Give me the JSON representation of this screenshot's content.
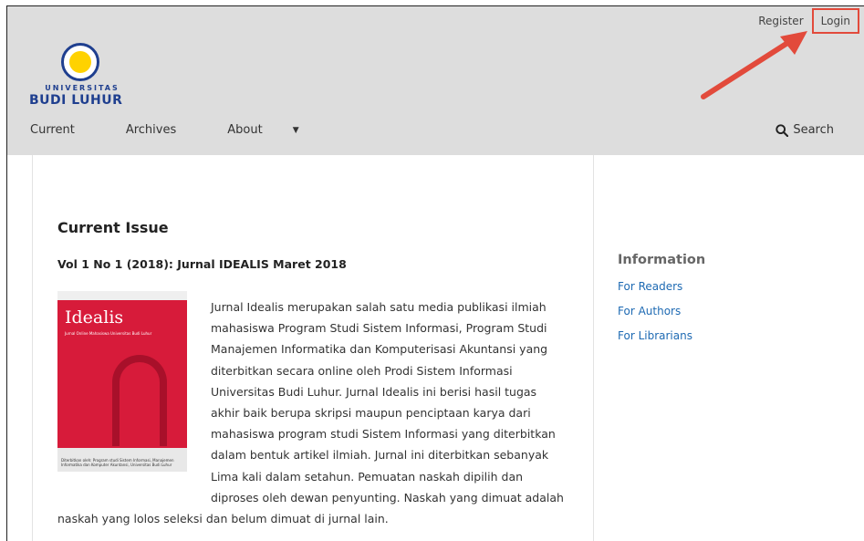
{
  "header": {
    "user_nav": {
      "register": "Register",
      "login": "Login"
    },
    "logo": {
      "line1": "UNIVERSITAS",
      "line2": "BUDI LUHUR"
    },
    "nav": [
      {
        "label": "Current"
      },
      {
        "label": "Archives"
      },
      {
        "label": "About"
      }
    ],
    "search_label": "Search"
  },
  "main": {
    "section_title": "Current Issue",
    "issue_title": "Vol 1 No 1 (2018): Jurnal IDEALIS Maret 2018",
    "cover": {
      "name": "Idealis",
      "subtitle": "Jurnal Online Mahasiswa Universitas Budi Luhur",
      "footer": "Diterbitkan oleh: Program studi Sistem Informasi, Manajemen Informatika dan Komputer Akuntansi, Universitas Budi Luhur"
    },
    "description": "Jurnal Idealis merupakan salah satu media publikasi ilmiah mahasiswa Program Studi Sistem Informasi, Program Studi Manajemen Informatika dan Komputerisasi Akuntansi yang diterbitkan secara online oleh Prodi Sistem Informasi Universitas Budi Luhur. Jurnal Idealis ini berisi hasil tugas akhir baik berupa skripsi maupun penciptaan karya dari mahasiswa program studi Sistem Informasi yang diterbitkan dalam bentuk artikel ilmiah. Jurnal ini diterbitkan sebanyak Lima kali dalam setahun. Pemuatan naskah dipilih dan diproses oleh dewan penyunting. Naskah yang dimuat adalah naskah yang lolos seleksi dan belum dimuat di jurnal lain."
  },
  "sidebar": {
    "title": "Information",
    "links": [
      {
        "label": "For Readers"
      },
      {
        "label": "For Authors"
      },
      {
        "label": "For Librarians"
      }
    ]
  },
  "colors": {
    "header_bg": "#dddddd",
    "link": "#1e6ab3",
    "highlight": "#e24a3b",
    "cover_red": "#d71b3a"
  }
}
